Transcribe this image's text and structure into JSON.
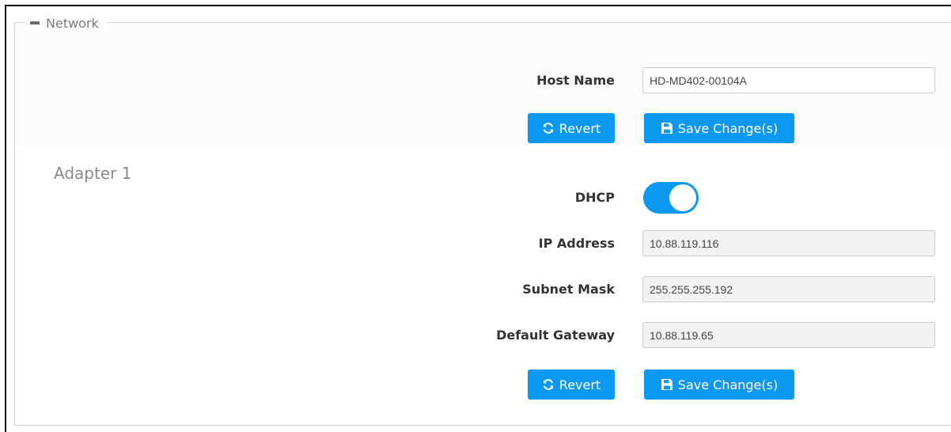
{
  "section": {
    "title": "Network"
  },
  "host": {
    "label": "Host Name",
    "value": "HD-MD402-00104A"
  },
  "adapter": {
    "title": "Adapter 1",
    "dhcp": {
      "label": "DHCP",
      "enabled": true
    },
    "ip": {
      "label": "IP Address",
      "value": "10.88.119.116"
    },
    "subnet": {
      "label": "Subnet Mask",
      "value": "255.255.255.192"
    },
    "gateway": {
      "label": "Default Gateway",
      "value": "10.88.119.65"
    }
  },
  "buttons": {
    "revert": "Revert",
    "save": "Save Change(s)"
  },
  "colors": {
    "accent": "#0a98f0",
    "readonly_bg": "#f2f2f2",
    "label": "#333333",
    "muted": "#8a8a8a"
  },
  "icons": {
    "revert": "refresh-icon",
    "save": "floppy-disk-icon",
    "collapse": "minus-icon"
  }
}
